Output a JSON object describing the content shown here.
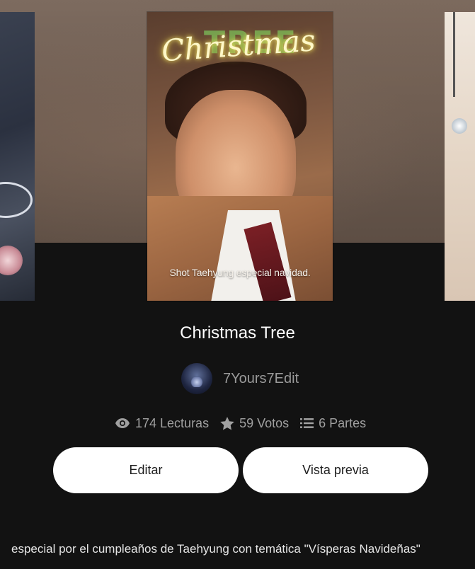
{
  "carousel": {
    "current_cover": {
      "title_art": "Christmas",
      "title_art_ghost": "TREE",
      "caption": "Shot Taehyung especial navidad."
    }
  },
  "story": {
    "title": "Christmas Tree",
    "author": "7Yours7Edit",
    "stats": {
      "reads": "174 Lecturas",
      "votes": "59 Votos",
      "parts": "6 Partes"
    },
    "edit_label": "Editar",
    "preview_label": "Vista previa",
    "description": "especial por el cumpleaños de Taehyung con temática \"Vísperas Navideñas\""
  },
  "icons": {
    "reads": "eye-icon",
    "votes": "star-icon",
    "parts": "list-icon"
  },
  "colors": {
    "background": "#121212",
    "button_bg": "#ffffff",
    "muted_text": "#a0a0a0"
  }
}
